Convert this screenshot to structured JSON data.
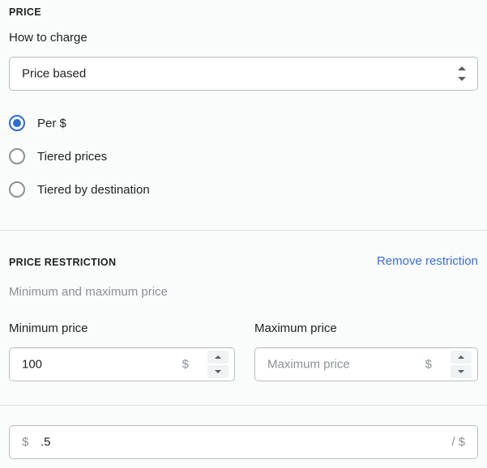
{
  "price_section": {
    "heading": "PRICE",
    "how_to_charge_label": "How to charge",
    "charge_select": {
      "value": "Price based",
      "icon": "select-chevrons-icon"
    },
    "rate_type_options": [
      {
        "label": "Per $",
        "selected": true
      },
      {
        "label": "Tiered prices",
        "selected": false
      },
      {
        "label": "Tiered by destination",
        "selected": false
      }
    ]
  },
  "price_restriction_section": {
    "heading": "PRICE RESTRICTION",
    "remove_link": "Remove restriction",
    "description": "Minimum and maximum price",
    "minimum": {
      "label": "Minimum price",
      "value": "100",
      "placeholder": "Minimum price",
      "currency_suffix": "$"
    },
    "maximum": {
      "label": "Maximum price",
      "value": "",
      "placeholder": "Maximum price",
      "currency_suffix": "$"
    }
  },
  "rate_section": {
    "prefix": "$",
    "value": ".5",
    "suffix": "/ $"
  },
  "colors": {
    "accent": "#2c6ecb",
    "link": "#3b6ecc",
    "text": "#202223",
    "muted": "#8c9196",
    "border": "#babfc3",
    "divider": "#e1e3e5",
    "background": "#fafbfb",
    "field_background": "#ffffff"
  }
}
